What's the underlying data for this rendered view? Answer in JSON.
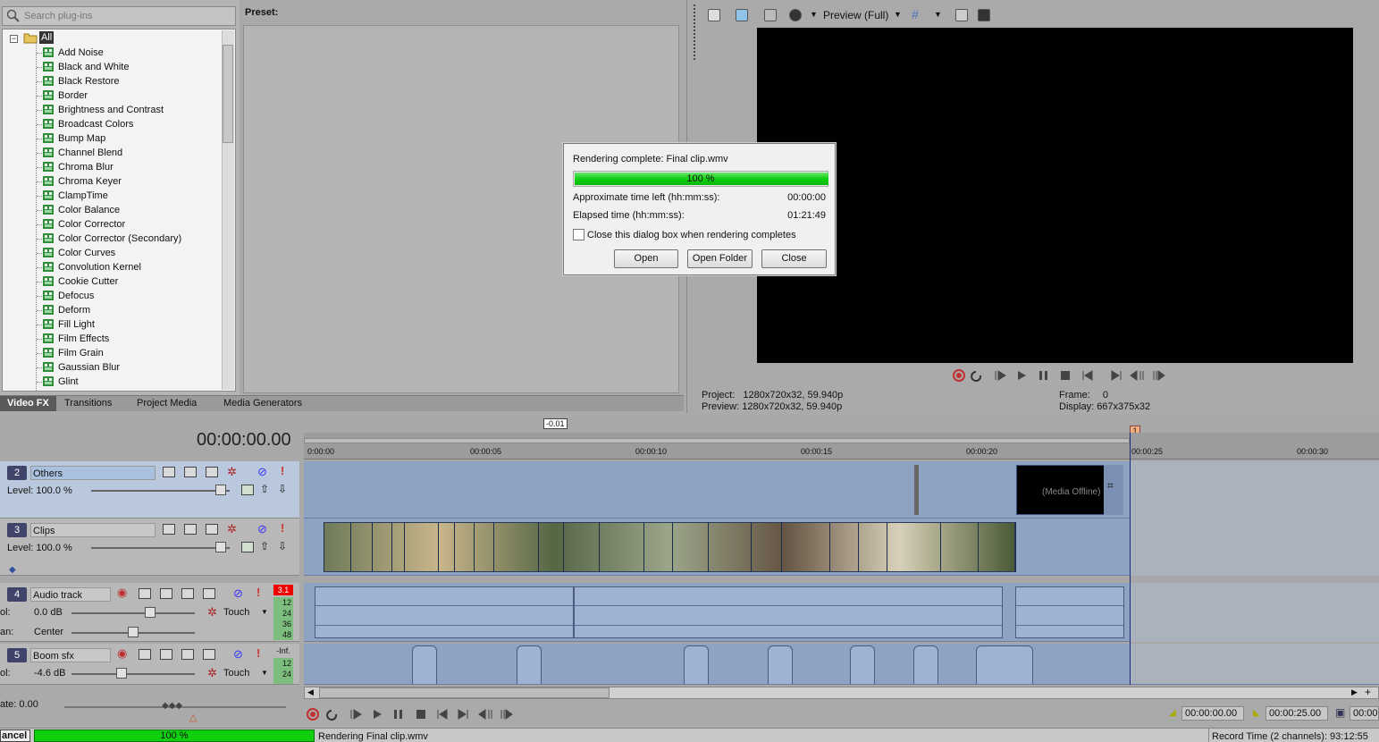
{
  "fx_panel": {
    "search_placeholder": "Search plug-ins",
    "root_label": "All",
    "items": [
      "Add Noise",
      "Black and White",
      "Black Restore",
      "Border",
      "Brightness and Contrast",
      "Broadcast Colors",
      "Bump Map",
      "Channel Blend",
      "Chroma Blur",
      "Chroma Keyer",
      "ClampTime",
      "Color Balance",
      "Color Corrector",
      "Color Corrector (Secondary)",
      "Color Curves",
      "Convolution Kernel",
      "Cookie Cutter",
      "Defocus",
      "Deform",
      "Fill Light",
      "Film Effects",
      "Film Grain",
      "Gaussian Blur",
      "Glint"
    ]
  },
  "preset": {
    "label": "Preset:"
  },
  "tabs": [
    "Video FX",
    "Transitions",
    "Project Media",
    "Media Generators"
  ],
  "preview": {
    "mode_label": "Preview (Full)",
    "project_label": "Project:",
    "project_value": "1280x720x32, 59.940p",
    "preview_label": "Preview:",
    "preview_value": "1280x720x32, 59.940p",
    "frame_label": "Frame:",
    "frame_value": "0",
    "display_label": "Display:",
    "display_value": "667x375x32"
  },
  "dialog": {
    "title": "Rendering complete: Final clip.wmv",
    "progress_text": "100 %",
    "progress_fraction": 1.0,
    "time_left_label": "Approximate time left (hh:mm:ss):",
    "time_left_value": "00:00:00",
    "elapsed_label": "Elapsed time (hh:mm:ss):",
    "elapsed_value": "01:21:49",
    "checkbox_label": "Close this dialog box when rendering completes",
    "open_label": "Open",
    "open_folder_label": "Open Folder",
    "close_label": "Close"
  },
  "timeline": {
    "timecode": "00:00:00.00",
    "offset_badge": "-0.01",
    "marker": "1",
    "ruler_ticks": [
      "0:00:00",
      "00:00:05",
      "00:00:10",
      "00:00:15",
      "00:00:20",
      "00:00:25",
      "00:00:30"
    ],
    "tracks": [
      {
        "num": "2",
        "name": "Others",
        "level": "Level: 100.0 %"
      },
      {
        "num": "3",
        "name": "Clips",
        "level": "Level: 100.0 %"
      },
      {
        "num": "4",
        "name": "Audio track",
        "vol": "ol:",
        "vol_value": "0.0 dB",
        "pan": "an:",
        "pan_value": "Center",
        "mode": "Touch",
        "meter": "3.1"
      },
      {
        "num": "5",
        "name": "Boom sfx",
        "vol": "ol:",
        "vol_value": "-4.6 dB",
        "mode": "Touch",
        "meter": "-Inf."
      }
    ],
    "media_offline": "(Media Offline)",
    "meter_scale": [
      "12",
      "24",
      "36",
      "48"
    ]
  },
  "bottom": {
    "rate": "ate: 0.00",
    "tc_start": "00:00:00.00",
    "tc_end": "00:00:25.00",
    "tc_len": "00:00",
    "cancel": "ancel",
    "progress_text": "100 %",
    "rendering": "Rendering Final clip.wmv",
    "record_time": "Record Time (2 channels): 93:12:55"
  },
  "colors": {
    "progress_green": "#0fcf0f",
    "track_blue": "#8ea2c2",
    "playhead": "#1b2a7a"
  }
}
